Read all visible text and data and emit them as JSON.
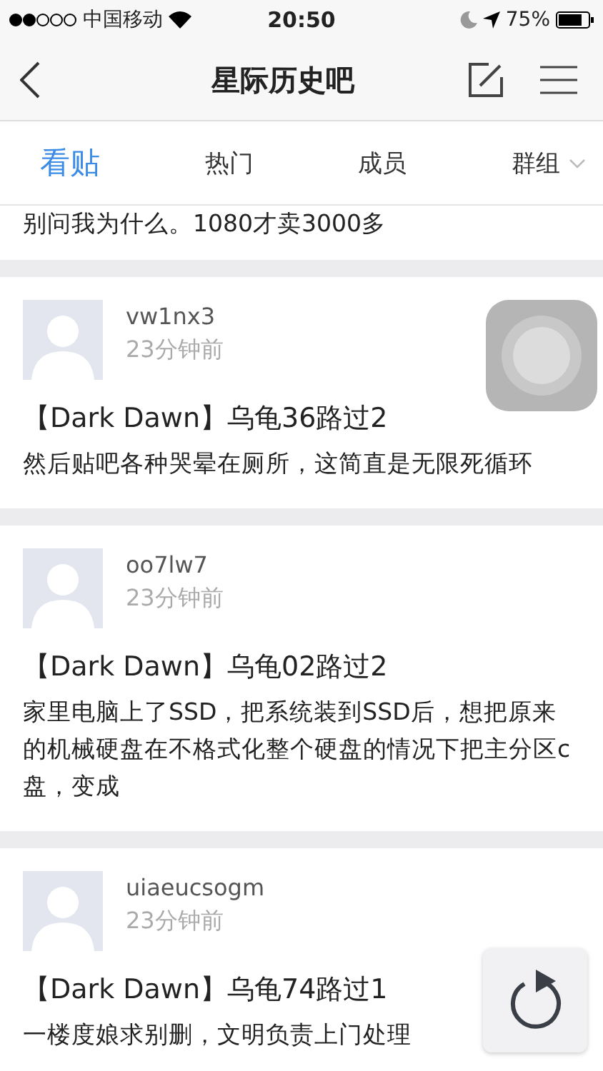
{
  "status_bar": {
    "carrier": "中国移动",
    "time": "20:50",
    "battery": "75%"
  },
  "nav": {
    "title": "星际历史吧"
  },
  "tabs": [
    {
      "label": "看贴",
      "selected": true,
      "dropdown": false
    },
    {
      "label": "热门",
      "selected": false,
      "dropdown": false
    },
    {
      "label": "成员",
      "selected": false,
      "dropdown": false
    },
    {
      "label": "群组",
      "selected": false,
      "dropdown": true
    }
  ],
  "partial_post": {
    "body": "别问我为什么。1080才卖3000多"
  },
  "posts": [
    {
      "user": "vw1nx3",
      "time": "23分钟前",
      "title": "【Dark Dawn】乌龟36路过2",
      "body": "然后贴吧各种哭晕在厕所，这简直是无限死循环"
    },
    {
      "user": "oo7lw7",
      "time": "23分钟前",
      "title": "【Dark Dawn】乌龟02路过2",
      "body": "家里电脑上了SSD，把系统装到SSD后，想把原来的机械硬盘在不格式化整个硬盘的情况下把主分区c盘，变成"
    },
    {
      "user": "uiaeucsogm",
      "time": "23分钟前",
      "title": "【Dark Dawn】乌龟74路过1",
      "body": "一楼度娘求别删，文明负责上门处理"
    }
  ]
}
